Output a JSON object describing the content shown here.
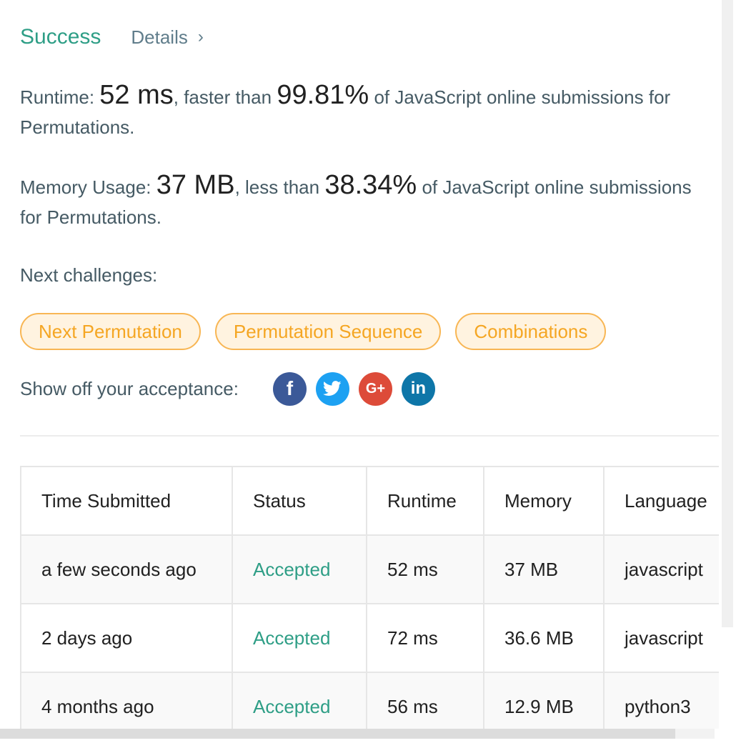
{
  "result": {
    "status": "Success",
    "details_label": "Details",
    "details_chevron": "›"
  },
  "runtime": {
    "label": "Runtime:",
    "value": "52 ms",
    "middle": ", faster than",
    "percent": "99.81%",
    "suffix": "of JavaScript online submissions for Permutations."
  },
  "memory": {
    "label": "Memory Usage:",
    "value": "37 MB",
    "middle": ", less than",
    "percent": "38.34%",
    "suffix": "of JavaScript online submissions for Permutations."
  },
  "next_challenges": {
    "label": "Next challenges:",
    "items": [
      "Next Permutation",
      "Permutation Sequence",
      "Combinations"
    ]
  },
  "share": {
    "label": "Show off your acceptance:",
    "facebook": "f",
    "google_plus": "G+",
    "linkedin": "in"
  },
  "submissions": {
    "columns": [
      "Time Submitted",
      "Status",
      "Runtime",
      "Memory",
      "Language"
    ],
    "rows": [
      [
        "a few seconds ago",
        "Accepted",
        "52 ms",
        "37 MB",
        "javascript"
      ],
      [
        "2 days ago",
        "Accepted",
        "72 ms",
        "36.6 MB",
        "javascript"
      ],
      [
        "4 months ago",
        "Accepted",
        "56 ms",
        "12.9 MB",
        "python3"
      ]
    ]
  },
  "colors": {
    "success": "#2e9e86",
    "chip_border": "#f8b654",
    "chip_text": "#f5a623",
    "facebook": "#3b5998",
    "twitter": "#1da1f2",
    "google_plus": "#dd4b39",
    "linkedin": "#0e76a8"
  }
}
